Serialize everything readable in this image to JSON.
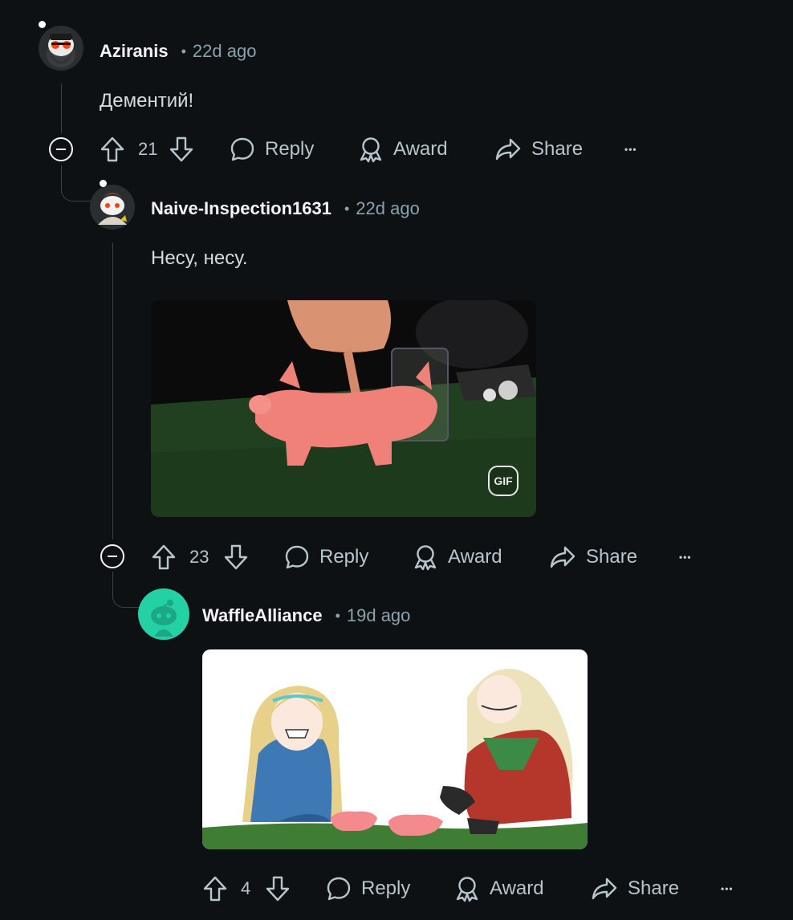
{
  "comments": [
    {
      "username": "Aziranis",
      "separator": "•",
      "time": "22d ago",
      "text": "Дементий!",
      "score": "21",
      "actions": {
        "reply": "Reply",
        "award": "Award",
        "share": "Share",
        "more": "•••"
      }
    },
    {
      "username": "Naive-Inspection1631",
      "separator": "•",
      "time": "22d ago",
      "text": "Несу, несу.",
      "media_badge": "GIF",
      "score": "23",
      "actions": {
        "reply": "Reply",
        "award": "Award",
        "share": "Share",
        "more": "•••"
      }
    },
    {
      "username": "WaffleAlliance",
      "separator": "•",
      "time": "19d ago",
      "score": "4",
      "actions": {
        "reply": "Reply",
        "award": "Award",
        "share": "Share",
        "more": "•••"
      }
    }
  ],
  "icons": {
    "upvote": "upvote-icon",
    "downvote": "downvote-icon",
    "reply": "comment-bubble-icon",
    "award": "award-icon",
    "share": "share-arrow-icon",
    "collapse": "collapse-minus-icon"
  },
  "colors": {
    "background": "#0e1113",
    "username": "#f2f4f5",
    "meta": "#8ba2ad",
    "thread_line": "#33464c",
    "snoo_teal": "#23d1a5"
  }
}
